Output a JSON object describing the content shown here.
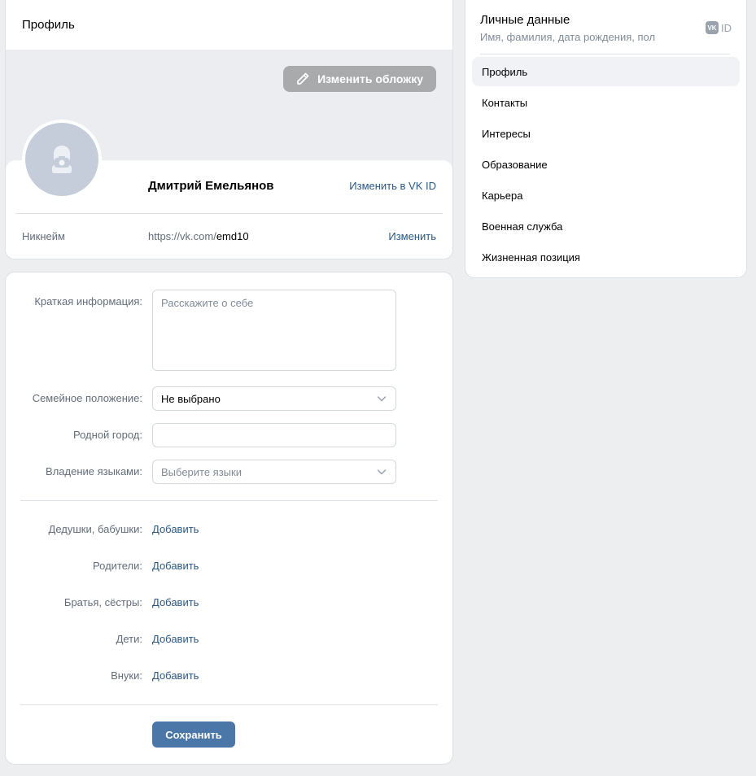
{
  "profile_card": {
    "title": "Профиль",
    "cover_button": "Изменить обложку",
    "name": "Дмитрий Емельянов",
    "vkid_link": "Изменить в VK ID",
    "nickname_label": "Никнейм",
    "nickname_url_prefix": "https://vk.com/",
    "nickname_value": "emd10",
    "nickname_change": "Изменить"
  },
  "form": {
    "about_label": "Краткая информация:",
    "about_placeholder": "Расскажите о себе",
    "family_label": "Семейное положение:",
    "family_value": "Не выбрано",
    "hometown_label": "Родной город:",
    "hometown_value": "",
    "languages_label": "Владение языками:",
    "languages_placeholder": "Выберите языки",
    "relatives": [
      {
        "label": "Дедушки, бабушки:",
        "action": "Добавить"
      },
      {
        "label": "Родители:",
        "action": "Добавить"
      },
      {
        "label": "Братья, сёстры:",
        "action": "Добавить"
      },
      {
        "label": "Дети:",
        "action": "Добавить"
      },
      {
        "label": "Внуки:",
        "action": "Добавить"
      }
    ],
    "save_button": "Сохранить"
  },
  "side_nav": {
    "title": "Личные данные",
    "subtitle": "Имя, фамилия, дата рождения, пол",
    "vkid_logo": "VK",
    "vkid_text": "ID",
    "items": [
      {
        "label": "Профиль",
        "active": true
      },
      {
        "label": "Контакты",
        "active": false
      },
      {
        "label": "Интересы",
        "active": false
      },
      {
        "label": "Образование",
        "active": false
      },
      {
        "label": "Карьера",
        "active": false
      },
      {
        "label": "Военная служба",
        "active": false
      },
      {
        "label": "Жизненная позиция",
        "active": false
      }
    ]
  },
  "colors": {
    "page_bg": "#edeef0",
    "link": "#2a5885",
    "primary_button": "#4a76a8",
    "cover_button": "#a9aaac"
  }
}
